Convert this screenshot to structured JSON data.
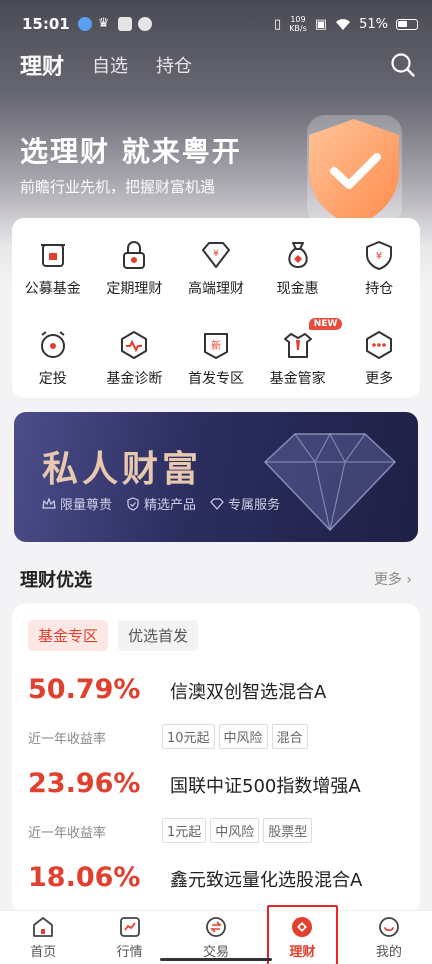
{
  "status": {
    "time": "15:01",
    "net_speed_value": "109",
    "net_speed_unit": "KB/s",
    "battery": "51%"
  },
  "topnav": {
    "tabs": [
      {
        "label": "理财",
        "active": true
      },
      {
        "label": "自选",
        "active": false
      },
      {
        "label": "持仓",
        "active": false
      }
    ]
  },
  "hero": {
    "title": "选理财 就来粤开",
    "subtitle": "前瞻行业先机，把握财富机遇"
  },
  "menu": {
    "items": [
      {
        "label": "公募基金",
        "icon": "fund-jar-icon"
      },
      {
        "label": "定期理财",
        "icon": "lock-icon"
      },
      {
        "label": "高端理财",
        "icon": "diamond-icon"
      },
      {
        "label": "现金惠",
        "icon": "money-bag-icon"
      },
      {
        "label": "持仓",
        "icon": "shield-yuan-icon"
      },
      {
        "label": "定投",
        "icon": "alarm-clock-icon"
      },
      {
        "label": "基金诊断",
        "icon": "pulse-icon"
      },
      {
        "label": "首发专区",
        "icon": "new-badge-icon"
      },
      {
        "label": "基金管家",
        "icon": "suit-icon",
        "badge": "NEW"
      },
      {
        "label": "更多",
        "icon": "more-dots-icon"
      }
    ]
  },
  "banner": {
    "title": "私人财富",
    "tags": [
      "限量尊贵",
      "精选产品",
      "专属服务"
    ]
  },
  "section": {
    "title": "理财优选",
    "more": "更多"
  },
  "chips": [
    "基金专区",
    "优选首发"
  ],
  "funds": [
    {
      "rate": "50.79%",
      "rate_label": "近一年收益率",
      "name": "信澳双创智选混合A",
      "tags": [
        "10元起",
        "中风险",
        "混合"
      ]
    },
    {
      "rate": "23.96%",
      "rate_label": "近一年收益率",
      "name": "国联中证500指数增强A",
      "tags": [
        "1元起",
        "中风险",
        "股票型"
      ]
    },
    {
      "rate": "18.06%",
      "rate_label": "近一年收益率",
      "name": "鑫元致远量化选股混合A",
      "tags": []
    }
  ],
  "bottombar": {
    "items": [
      {
        "label": "首页",
        "icon": "home-icon"
      },
      {
        "label": "行情",
        "icon": "chart-icon"
      },
      {
        "label": "交易",
        "icon": "exchange-icon"
      },
      {
        "label": "理财",
        "icon": "wealth-icon",
        "active": true
      },
      {
        "label": "我的",
        "icon": "smile-icon"
      }
    ]
  },
  "colors": {
    "accent": "#e2402f",
    "banner_text": "#e8c9b0",
    "highlight": "#e8262a"
  }
}
